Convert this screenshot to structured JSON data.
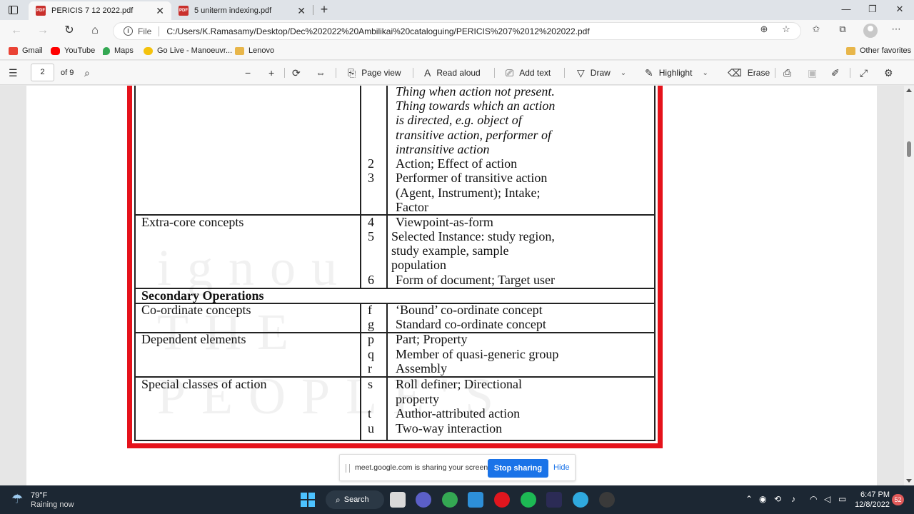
{
  "browser": {
    "tabs": [
      {
        "title": "PERICIS 7 12 2022.pdf",
        "active": true
      },
      {
        "title": "5 uniterm indexing.pdf",
        "active": false
      }
    ],
    "address": {
      "scheme": "File",
      "url": "C:/Users/K.Ramasamy/Desktop/Dec%202022%20Ambilikai%20cataloguing/PERICIS%207%2012%202022.pdf"
    },
    "bookmarks": [
      {
        "label": "Gmail",
        "color": "#ea4335"
      },
      {
        "label": "YouTube",
        "color": "#ff0000"
      },
      {
        "label": "Maps",
        "color": "#34a853"
      },
      {
        "label": "Go Live - Manoeuvr...",
        "color": "#f4c20d"
      },
      {
        "label": "Lenovo",
        "color": "#e8b64a"
      }
    ],
    "other_favorites": "Other favorites"
  },
  "pdf_toolbar": {
    "page_current": "2",
    "page_total": "of 9",
    "page_view": "Page view",
    "read_aloud": "Read aloud",
    "add_text": "Add text",
    "draw": "Draw",
    "highlight": "Highlight",
    "erase": "Erase"
  },
  "document": {
    "top_right_lines": [
      "Thing when action not present.",
      "Thing towards which an action",
      "is directed, e.g. object of",
      "transitive action, performer of",
      "intransitive action"
    ],
    "top_rows": [
      {
        "code": "2",
        "lines": [
          "Action; Effect of action"
        ]
      },
      {
        "code": "3",
        "lines": [
          "Performer of transitive action",
          "(Agent, Instrument); Intake;",
          "Factor"
        ]
      }
    ],
    "extra_core": {
      "label": "Extra-core concepts",
      "rows": [
        {
          "code": "4",
          "lines": [
            "Viewpoint-as-form"
          ]
        },
        {
          "code": "5",
          "lines": [
            "Selected Instance: study region,",
            "study example, sample",
            "population"
          ]
        },
        {
          "code": "6",
          "lines": [
            "Form of document; Target user"
          ]
        }
      ]
    },
    "secondary_heading": "Secondary Operations",
    "coordinate": {
      "label": "Co-ordinate concepts",
      "rows": [
        {
          "code": "f",
          "text": "‘Bound’ co-ordinate concept"
        },
        {
          "code": "g",
          "text": "Standard co-ordinate concept"
        }
      ]
    },
    "dependent": {
      "label": "Dependent elements",
      "rows": [
        {
          "code": "p",
          "text": "Part; Property"
        },
        {
          "code": "q",
          "text": "Member of quasi-generic group"
        },
        {
          "code": "r",
          "text": "Assembly"
        }
      ]
    },
    "special": {
      "label": "Special classes of action",
      "rows": [
        {
          "code": "s",
          "lines": [
            "Roll definer; Directional",
            "property"
          ]
        },
        {
          "code": "t",
          "lines": [
            "Author-attributed action"
          ]
        },
        {
          "code": "u",
          "lines": [
            "Two-way interaction"
          ]
        }
      ]
    },
    "frame_color": "#e5121b"
  },
  "share_banner": {
    "message": "meet.google.com is sharing your screen.",
    "stop": "Stop sharing",
    "hide": "Hide"
  },
  "taskbar": {
    "temperature": "79°F",
    "weather": "Raining now",
    "search": "Search",
    "time": "6:47 PM",
    "date": "12/8/2022",
    "notifications": "52"
  }
}
